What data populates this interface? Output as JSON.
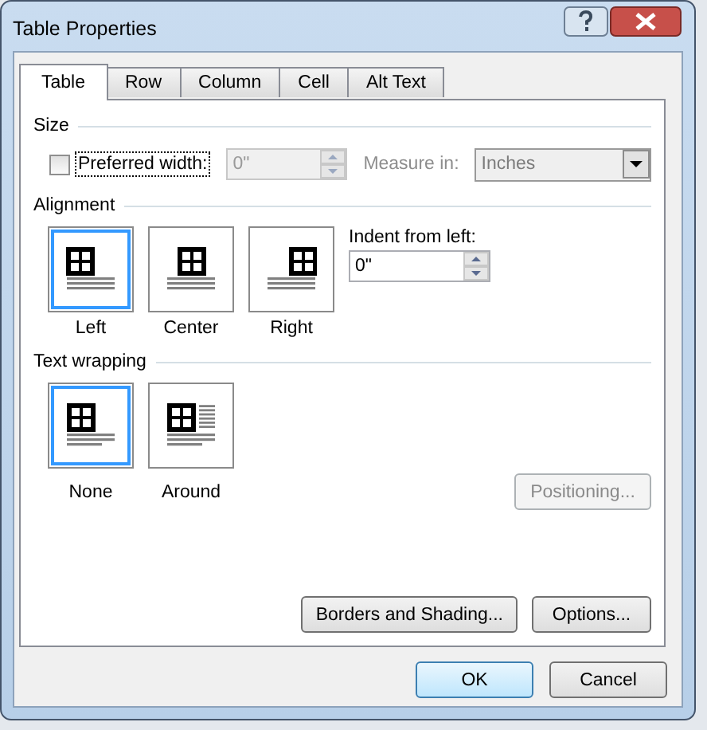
{
  "window": {
    "title": "Table Properties"
  },
  "tabs": [
    {
      "label": "Table",
      "selected": true
    },
    {
      "label": "Row",
      "selected": false
    },
    {
      "label": "Column",
      "selected": false
    },
    {
      "label": "Cell",
      "selected": false
    },
    {
      "label": "Alt Text",
      "selected": false
    }
  ],
  "size": {
    "heading": "Size",
    "preferred_width": {
      "label": "Preferred width:",
      "checked": false,
      "focused": true
    },
    "width_field": {
      "value": "0\"",
      "disabled": true
    },
    "measure_label": {
      "label": "Measure in:",
      "disabled": true
    },
    "measure_select": {
      "value": "Inches",
      "disabled": true
    }
  },
  "alignment": {
    "heading": "Alignment",
    "options": [
      {
        "label": "Left",
        "kind": "left",
        "selected": true
      },
      {
        "label": "Center",
        "kind": "center",
        "selected": false
      },
      {
        "label": "Right",
        "kind": "right",
        "selected": false
      }
    ],
    "indent": {
      "label": "Indent from left:",
      "value": "0\""
    }
  },
  "text_wrapping": {
    "heading": "Text wrapping",
    "options": [
      {
        "label": "None",
        "kind": "none",
        "selected": true
      },
      {
        "label": "Around",
        "kind": "around",
        "selected": false
      }
    ],
    "positioning": {
      "label": "Positioning...",
      "disabled": true
    }
  },
  "panel_buttons": [
    {
      "label": "Borders and Shading..."
    },
    {
      "label": "Options..."
    }
  ],
  "dialog_buttons": [
    {
      "label": "OK",
      "default": true
    },
    {
      "label": "Cancel",
      "default": false
    }
  ]
}
